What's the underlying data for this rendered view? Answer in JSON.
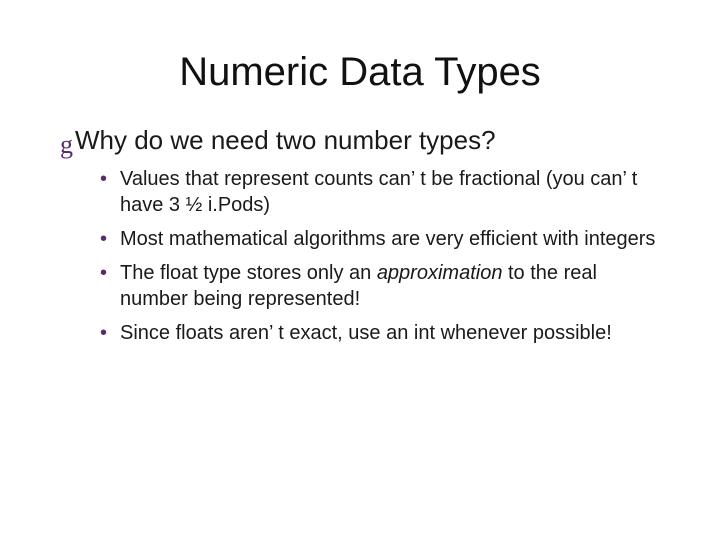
{
  "title": "Numeric Data Types",
  "main_bullet": "Why do we need two number types?",
  "sub": {
    "b1a": "Values that represent counts can",
    "b1b": "t be fractional (you can",
    "b1c": "t have 3 ½ i.Pods)",
    "b2": "Most mathematical algorithms are very efficient with integers",
    "b3a": "The float type stores only an ",
    "b3b": "approximation",
    "b3c": " to the real number being represented!",
    "b4a": "Since floats aren",
    "b4b": "t exact, use an int whenever possible!"
  },
  "apos": "’ "
}
